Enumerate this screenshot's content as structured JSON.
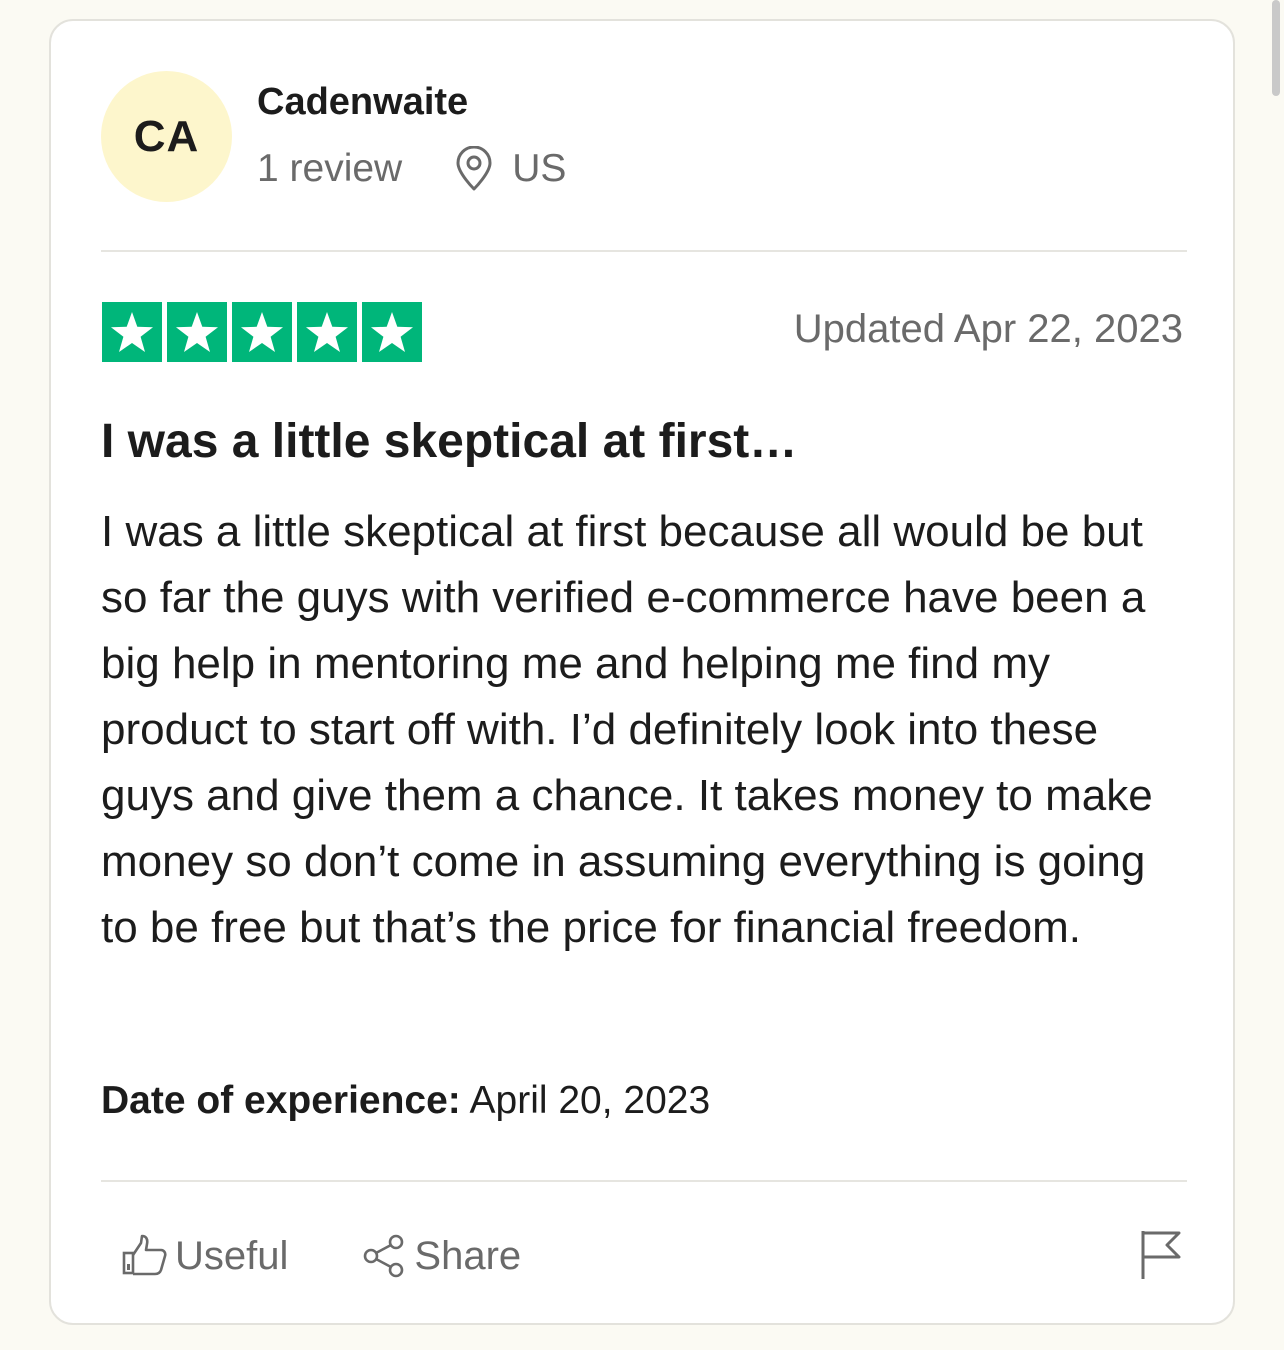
{
  "reviewer": {
    "initials": "CA",
    "name": "Cadenwaite",
    "review_count": "1 review",
    "country": "US",
    "avatar_color": "#fdf6cc"
  },
  "review": {
    "rating": 5,
    "rating_max": 5,
    "star_color": "#00b67a",
    "updated": "Updated Apr 22, 2023",
    "title": "I was a little skeptical at first…",
    "body": "I was a little skeptical at first because all would be but so far the guys with verified e-commerce have been a big help in mentoring me and helping me find my product to start off with. I’d definitely look into these guys and give them a chance. It takes money to make money so don’t come in assuming everything is going to be free but that’s the price for financial freedom.",
    "date_label": "Date of experience:",
    "date_value": "April 20, 2023"
  },
  "actions": {
    "useful_label": "Useful",
    "useful_icon": "thumbs-up-icon",
    "share_label": "Share",
    "share_icon": "share-icon",
    "report_icon": "flag-icon"
  }
}
